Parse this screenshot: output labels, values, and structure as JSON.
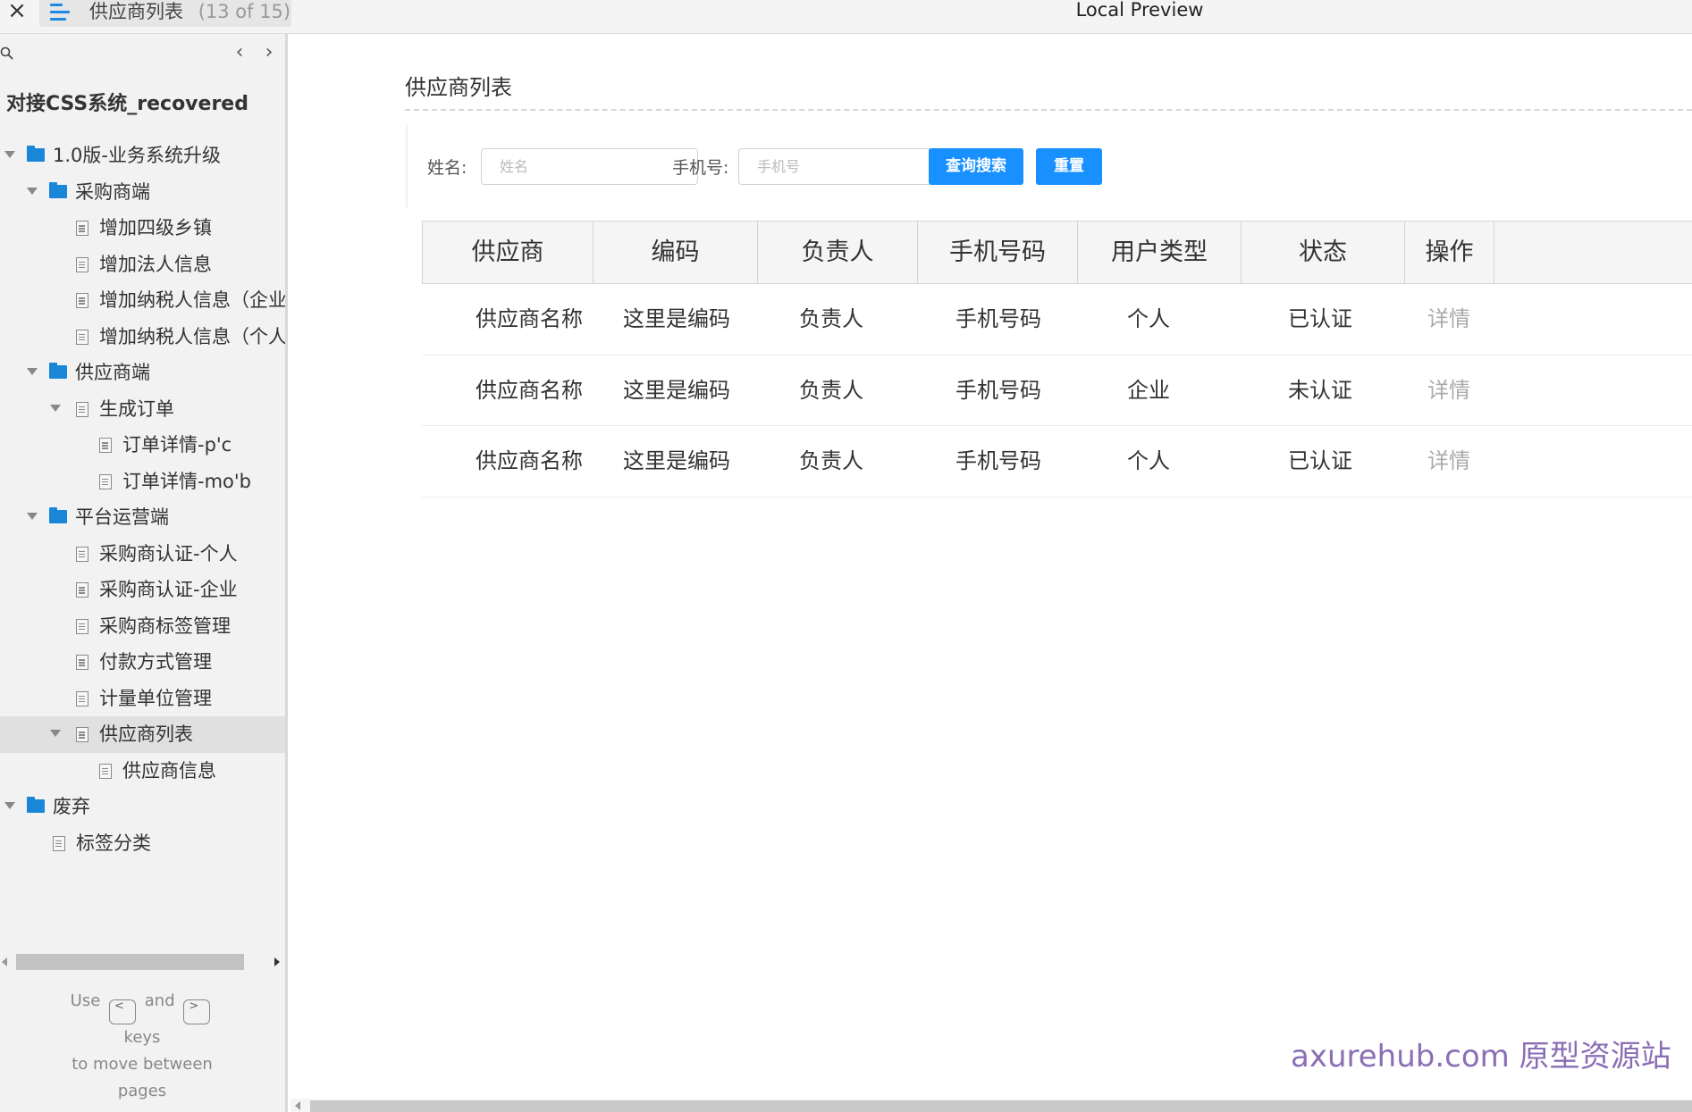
{
  "topbar": {
    "close_icon": "×",
    "tab_title": "供应商列表",
    "tab_count": "(13 of 15)",
    "preview_title": "Local Preview"
  },
  "sidebar": {
    "prev_icon": "‹",
    "next_icon": "›",
    "project_title": "对接CSS系统_recovered",
    "tree": [
      {
        "label": "1.0版-业务系统升级",
        "type": "folder",
        "level": 0,
        "expanded": true
      },
      {
        "label": "采购商端",
        "type": "folder",
        "level": 1,
        "expanded": true
      },
      {
        "label": "增加四级乡镇",
        "type": "page",
        "level": 2
      },
      {
        "label": "增加法人信息",
        "type": "page",
        "level": 2
      },
      {
        "label": "增加纳税人信息（企业）",
        "type": "page",
        "level": 2
      },
      {
        "label": "增加纳税人信息（个人）",
        "type": "page",
        "level": 2
      },
      {
        "label": "供应商端",
        "type": "folder",
        "level": 1,
        "expanded": true
      },
      {
        "label": "生成订单",
        "type": "page",
        "level": 2,
        "expanded": true
      },
      {
        "label": "订单详情-p'c",
        "type": "page",
        "level": 3
      },
      {
        "label": "订单详情-mo'b",
        "type": "page",
        "level": 3
      },
      {
        "label": "平台运营端",
        "type": "folder",
        "level": 1,
        "expanded": true
      },
      {
        "label": "采购商认证-个人",
        "type": "page",
        "level": 2
      },
      {
        "label": "采购商认证-企业",
        "type": "page",
        "level": 2
      },
      {
        "label": "采购商标签管理",
        "type": "page",
        "level": 2
      },
      {
        "label": "付款方式管理",
        "type": "page",
        "level": 2
      },
      {
        "label": "计量单位管理",
        "type": "page",
        "level": 2
      },
      {
        "label": "供应商列表",
        "type": "page",
        "level": 2,
        "expanded": true,
        "selected": true
      },
      {
        "label": "供应商信息",
        "type": "page",
        "level": 3
      },
      {
        "label": "废弃",
        "type": "folder",
        "level": 0,
        "expanded": true
      },
      {
        "label": "标签分类",
        "type": "page",
        "level": 1
      }
    ],
    "hint": {
      "use": "Use",
      "key_prev": "<",
      "and": "and",
      "key_next": ">",
      "keys": "keys",
      "line3": "to move between",
      "line4": "pages"
    }
  },
  "main": {
    "page_title": "供应商列表",
    "filters": {
      "name_label": "姓名:",
      "name_placeholder": "姓名",
      "name_value": "",
      "phone_label": "手机号:",
      "phone_placeholder": "手机号",
      "phone_value": "",
      "search_button": "查询搜索",
      "reset_button": "重置"
    },
    "table": {
      "headers": [
        "供应商",
        "编码",
        "负责人",
        "手机号码",
        "用户类型",
        "状态",
        "操作"
      ],
      "rows": [
        [
          "供应商名称",
          "这里是编码",
          "负责人",
          "手机号码",
          "个人",
          "已认证",
          "详情"
        ],
        [
          "供应商名称",
          "这里是编码",
          "负责人",
          "手机号码",
          "企业",
          "未认证",
          "详情"
        ],
        [
          "供应商名称",
          "这里是编码",
          "负责人",
          "手机号码",
          "个人",
          "已认证",
          "详情"
        ]
      ]
    },
    "watermark": "axurehub.com 原型资源站"
  },
  "colors": {
    "accent": "#1890ff",
    "folder": "#1a86d8",
    "tab_icon": "#1e88e5",
    "watermark": "#8a6fb5"
  },
  "icons": {
    "close": "close-icon",
    "menu": "hamburger-menu-icon",
    "search": "search-icon",
    "prev": "chevron-left-icon",
    "next": "chevron-right-icon",
    "folder": "folder-icon",
    "page": "page-icon",
    "expand": "caret-down-icon"
  }
}
